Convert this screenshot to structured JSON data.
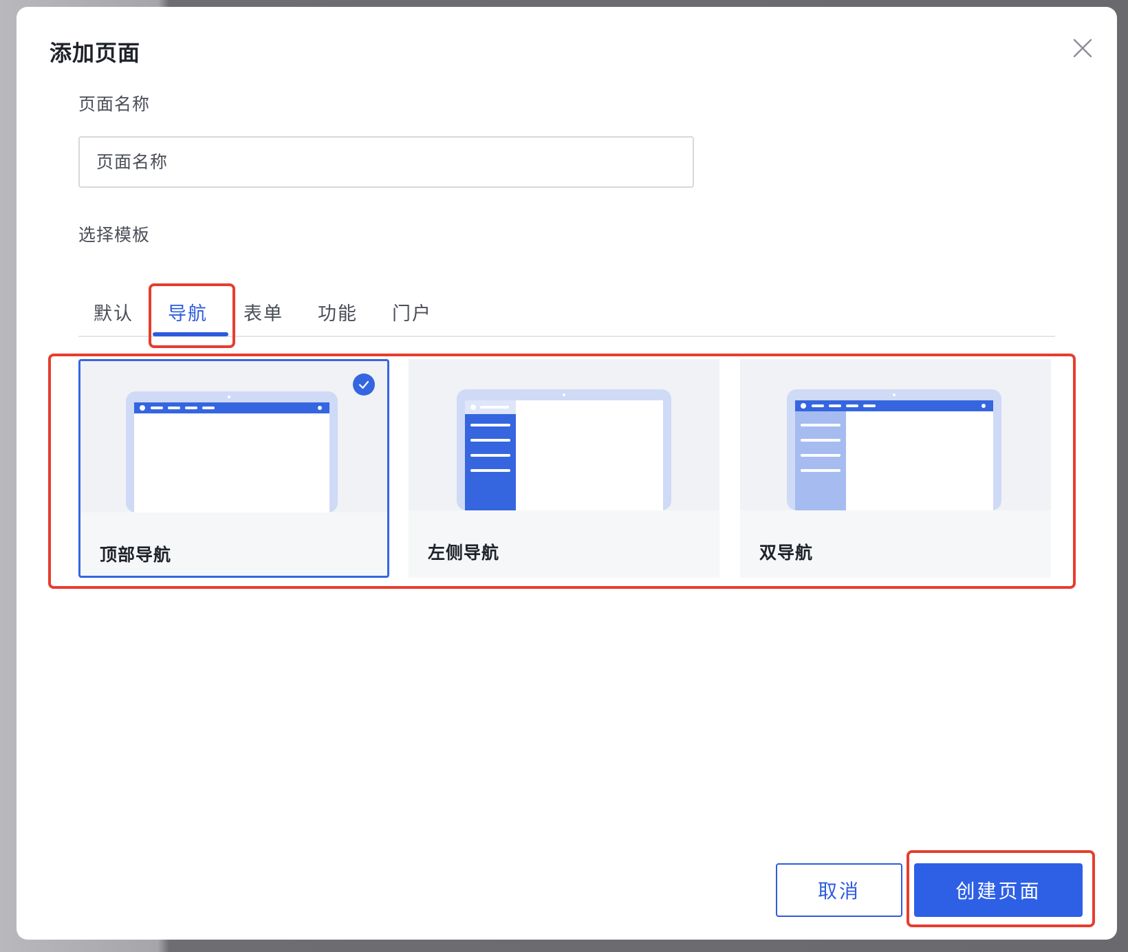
{
  "dialog": {
    "title": "添加页面",
    "close_icon": "close-icon"
  },
  "form": {
    "name_label": "页面名称",
    "name_placeholder": "页面名称",
    "name_value": "",
    "template_label": "选择模板"
  },
  "tabs": [
    {
      "label": "默认",
      "active": false
    },
    {
      "label": "导航",
      "active": true
    },
    {
      "label": "表单",
      "active": false
    },
    {
      "label": "功能",
      "active": false
    },
    {
      "label": "门户",
      "active": false
    }
  ],
  "templates": [
    {
      "label": "顶部导航",
      "selected": true,
      "preview_icon": "top-nav-preview-icon"
    },
    {
      "label": "左侧导航",
      "selected": false,
      "preview_icon": "left-nav-preview-icon"
    },
    {
      "label": "双导航",
      "selected": false,
      "preview_icon": "dual-nav-preview-icon"
    }
  ],
  "footer": {
    "cancel_label": "取消",
    "create_label": "创建页面"
  },
  "colors": {
    "accent": "#2e60e6",
    "highlight": "#e63d2e",
    "title": "#1f2329",
    "muted_text": "#4a4e57"
  }
}
